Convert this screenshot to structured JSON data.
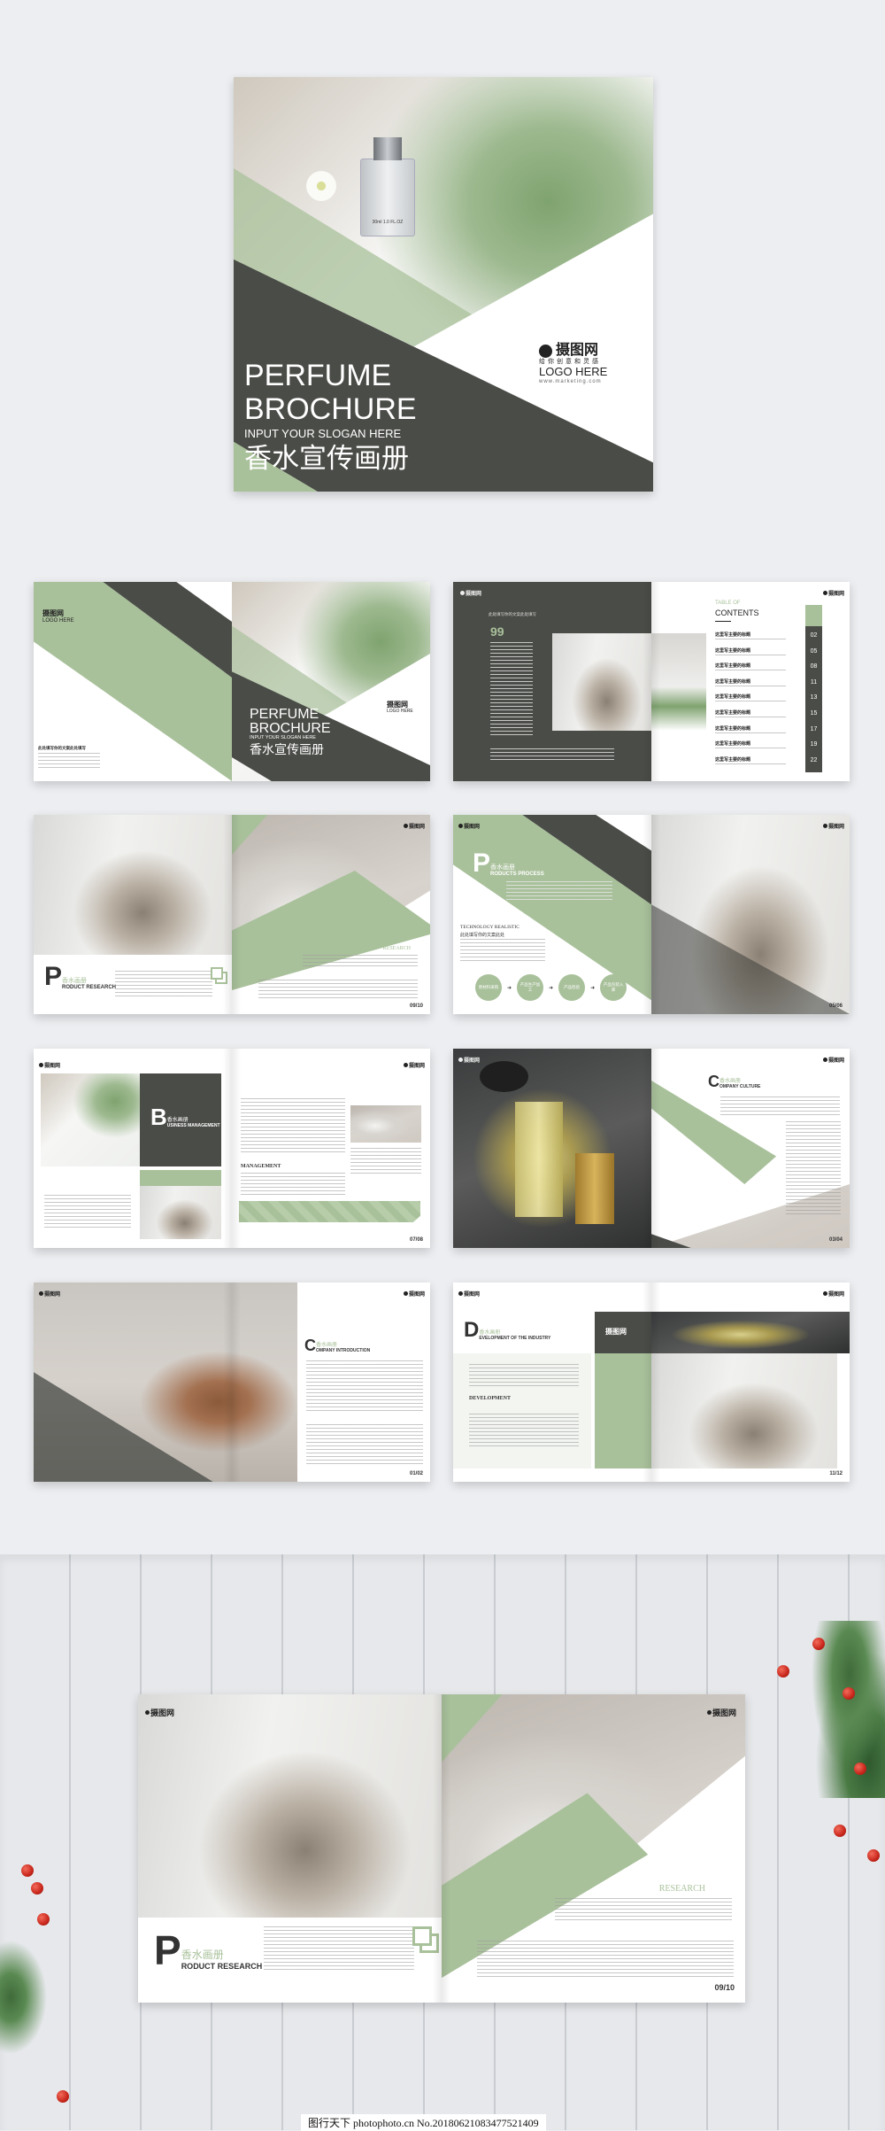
{
  "colors": {
    "green": "#a9c19b",
    "dark": "#4a4c47",
    "background": "#eceef1"
  },
  "logo": {
    "name": "摄图网",
    "tagline": "给你创意和灵感",
    "text": "LOGO HERE",
    "url": "www.marketing.com",
    "icon": "camera-aperture-icon"
  },
  "cover": {
    "title1": "PERFUME",
    "title2": "BROCHURE",
    "slogan": "INPUT YOUR SLOGAN HERE",
    "title_cn": "香水宣传画册",
    "bottle_label": "30ml 1.0 FL.OZ"
  },
  "mini_logo": "摄图网",
  "toc": {
    "label_top": "TABLE OF",
    "label": "CONTENTS",
    "quote_mark": "99",
    "items": [
      {
        "title": "这里写主要的标题",
        "page": "02"
      },
      {
        "title": "这里写主要的标题",
        "page": "05"
      },
      {
        "title": "这里写主要的标题",
        "page": "08"
      },
      {
        "title": "这里写主要的标题",
        "page": "11"
      },
      {
        "title": "这里写主要的标题",
        "page": "13"
      },
      {
        "title": "这里写主要的标题",
        "page": "15"
      },
      {
        "title": "这里写主要的标题",
        "page": "17"
      },
      {
        "title": "这里写主要的标题",
        "page": "19"
      },
      {
        "title": "这里写主要的标题",
        "page": "22"
      }
    ]
  },
  "back_cover": {
    "heading": "此处填写你的文案此处填写"
  },
  "product_research": {
    "letter": "P",
    "cn": "香水画册",
    "rest": "RODUCT RESEARCH",
    "research": "RESEARCH",
    "pages": "09/10"
  },
  "products_process": {
    "letter": "P",
    "cn": "香水画册",
    "rest": "RODUCTS PROCESS",
    "tech": "TECHNOLOGY REALISTIC",
    "tech_cn": "此处填写你的文案此处",
    "steps": [
      "原材料采购",
      "产品生产加工",
      "产品检验",
      "产品包装入库"
    ],
    "pages": "05/06"
  },
  "business": {
    "letter": "B",
    "cn": "香水画册",
    "rest": "USINESS MANAGEMENT",
    "management": "MANAGEMENT",
    "pages": "07/08"
  },
  "culture": {
    "letter": "C",
    "cn": "香水画册",
    "rest": "OMPANY CULTURE",
    "pages": "03/04"
  },
  "intro": {
    "letter": "C",
    "cn": "香水画册",
    "rest": "OMPANY INTRODUCTION",
    "pages": "01/02"
  },
  "development": {
    "letter": "D",
    "cn": "香水画册",
    "rest": "EVELOPMENT OF THE INDUSTRY",
    "development": "DEVELOPMENT",
    "pages": "11/12"
  },
  "watermark": "图行天下 photophoto.cn  No.20180621083477521409"
}
